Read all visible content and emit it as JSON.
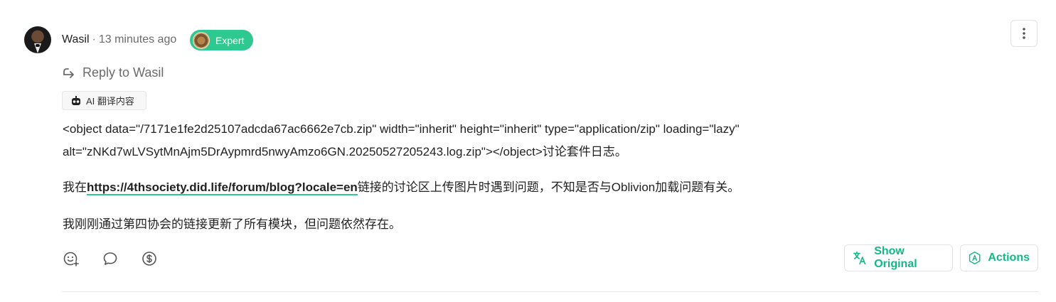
{
  "post": {
    "author": "Wasil",
    "separator": "·",
    "time": "13 minutes ago",
    "badge": {
      "label": "Expert",
      "color": "#2ec990"
    },
    "reply_to": "Reply to Wasil",
    "ai_tag": "AI 翻译内容",
    "content": {
      "p1": "<object data=\"/7171e1fe2d25107adcda67ac6662e7cb.zip\" width=\"inherit\" height=\"inherit\" type=\"application/zip\" loading=\"lazy\" alt=\"zNKd7wLVSytMnAjm5DrAypmrd5nwyAmzo6GN.20250527205243.log.zip\"></object>讨论套件日志。",
      "p2_prefix": "我在",
      "p2_link": "https://4thsociety.did.life/forum/blog?locale=en",
      "p2_suffix": "链接的讨论区上传图片时遇到问题，不知是否与Oblivion加载问题有关。",
      "p3": "我刚刚通过第四协会的链接更新了所有模块，但问题依然存在。"
    },
    "actions": {
      "show_original": "Show Original",
      "actions_label": "Actions"
    },
    "icons": {
      "reactions": "emoji-add-icon",
      "reply": "comment-icon",
      "tip": "dollar-icon",
      "menu": "vertical-dots-icon",
      "translate": "translate-icon",
      "actions": "hexagon-a-icon"
    },
    "accent_color": "#14b886"
  }
}
